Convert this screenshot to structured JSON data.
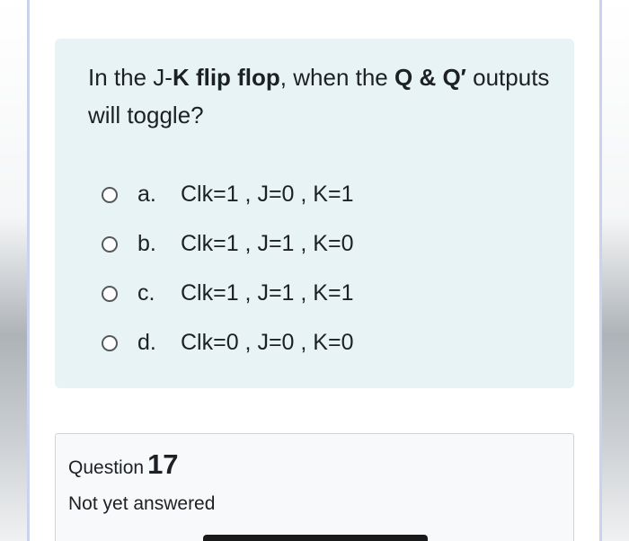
{
  "question": {
    "text_prefix": "In the J-",
    "text_bold1": "K flip flop",
    "text_mid": ", when the ",
    "text_bold2": "Q & Q′",
    "text_suffix": " outputs will toggle?"
  },
  "options": [
    {
      "letter": "a.",
      "text": "Clk=1 , J=0 , K=1"
    },
    {
      "letter": "b.",
      "text": "Clk=1 , J=1 , K=0"
    },
    {
      "letter": "c.",
      "text": "Clk=1 , J=1 , K=1"
    },
    {
      "letter": "d.",
      "text": "Clk=0 , J=0 , K=0"
    }
  ],
  "info": {
    "question_label": "Question",
    "question_number": "17",
    "status": "Not yet answered"
  }
}
